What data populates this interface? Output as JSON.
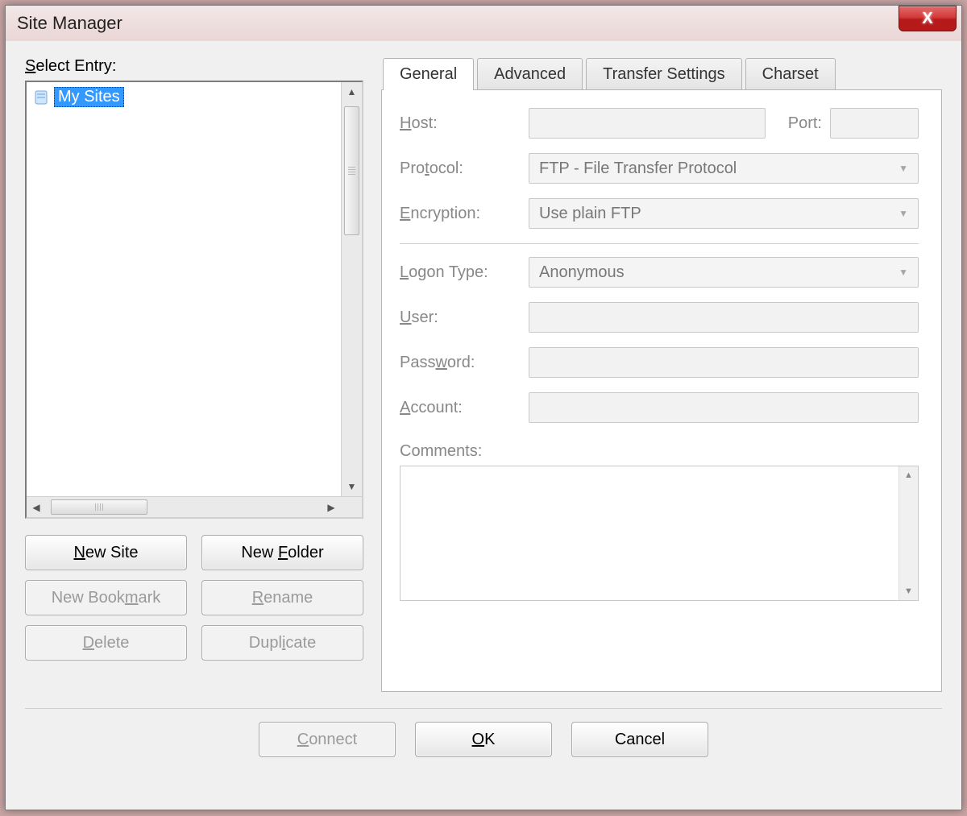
{
  "window": {
    "title": "Site Manager"
  },
  "left": {
    "label_pre": "S",
    "label_ul": "",
    "label_full_pre": "",
    "label": "Select Entry:",
    "tree_root": "My Sites",
    "buttons": {
      "new_site": "New Site",
      "new_folder": "New Folder",
      "new_bookmark": "New Bookmark",
      "rename": "Rename",
      "delete": "Delete",
      "duplicate": "Duplicate"
    }
  },
  "tabs": {
    "general": "General",
    "advanced": "Advanced",
    "transfer": "Transfer Settings",
    "charset": "Charset"
  },
  "form": {
    "host_label": "Host:",
    "port_label": "Port:",
    "protocol_label": "Protocol:",
    "protocol_value": "FTP - File Transfer Protocol",
    "encryption_label": "Encryption:",
    "encryption_value": "Use plain FTP",
    "logon_label": "Logon Type:",
    "logon_value": "Anonymous",
    "user_label": "User:",
    "password_label": "Password:",
    "account_label": "Account:",
    "comments_label": "Comments:"
  },
  "footer": {
    "connect": "Connect",
    "ok": "OK",
    "cancel": "Cancel"
  }
}
